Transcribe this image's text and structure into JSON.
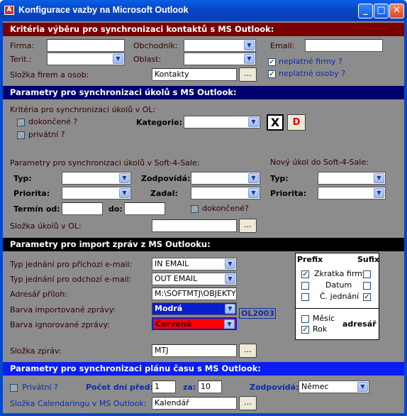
{
  "window": {
    "title": "Konfigurace vazby na Microsoft Outlook",
    "min": "_",
    "max": "□",
    "close": "✕"
  },
  "contacts": {
    "header": "Kritéria výběru pro synchronizaci kontaktů s MS Outlook:",
    "firma": "Firma:",
    "obchodnik": "Obchodník:",
    "email": "Email:",
    "terit": "Terit.:",
    "oblast": "Oblast:",
    "neplatne_firmy": "neplatné firmy ?",
    "neplatne_osoby": "neplatné osoby ?",
    "slozka_label": "Složka firem a osob:",
    "slozka_value": "Kontakty",
    "browse": "..."
  },
  "tasks": {
    "header": "Parametry pro synchronizaci úkolů s MS Outlook:",
    "criteria_label": "Kritéria pro synchronizaci úkolů v OL:",
    "dokoncene": "dokončené ?",
    "privatni": "privátní ?",
    "kategorie": "Kategorie:",
    "x_btn": "X",
    "d_btn": "D",
    "params_label": "Parametry pro synchronizaci úkolů v Soft-4-Sale:",
    "new_task_label": "Nový úkol do Soft-4-Sale:",
    "typ": "Typ:",
    "zodpovida": "Zodpovídá:",
    "priorita": "Priorita:",
    "zadal": "Zadal:",
    "termin_od": "Termín od:",
    "do": "do:",
    "dokoncene2": "dokončené?",
    "typ2": "Typ:",
    "priorita2": "Priorita:",
    "slozka_label": "Složka úkolů v OL:",
    "browse": "..."
  },
  "import": {
    "header": "Parametry pro import zpráv z MS Outlooku:",
    "incoming_label": "Typ jednání pro příchozí e-mail:",
    "incoming_value": "IN EMAIL",
    "outgoing_label": "Typ jednání pro odchozí e-mail:",
    "outgoing_value": "OUT EMAIL",
    "attach_label": "Adresář příloh:",
    "attach_value": "M:\\SOFTMTJ\\OBJEKTY",
    "color_import_label": "Barva importované zprávy:",
    "color_import_value": "Modrá",
    "color_ignore_label": "Barva ignorované zprávy:",
    "color_ignore_value": "Červená",
    "ol2003": "OL2003",
    "slozka_label": "Složka zpráv:",
    "slozka_value": "MTJ",
    "browse": "...",
    "prefix": "Prefix",
    "sufix": "Sufix",
    "zkratka": "Zkratka firmy",
    "datum": "Datum",
    "cislo": "Č. jednání",
    "mesic": "Měsíc",
    "rok": "Rok",
    "adresar": "adresář",
    "colors": {
      "blue": "#0a1ed0",
      "red": "#ff0000"
    }
  },
  "calendar": {
    "header": "Parametry pro synchronizaci plánu času s MS Outlook:",
    "privatni": "Privátní ?",
    "pocet_label": "Počet dní před:",
    "pocet_value": "1",
    "za_label": "za:",
    "za_value": "10",
    "zodpovida": "Zodpovídá:",
    "zodpovida_value": "Němec",
    "slozka_label": "Složka Calendaringu v MS Outlook:",
    "slozka_value": "Kalendář",
    "browse": "..."
  }
}
